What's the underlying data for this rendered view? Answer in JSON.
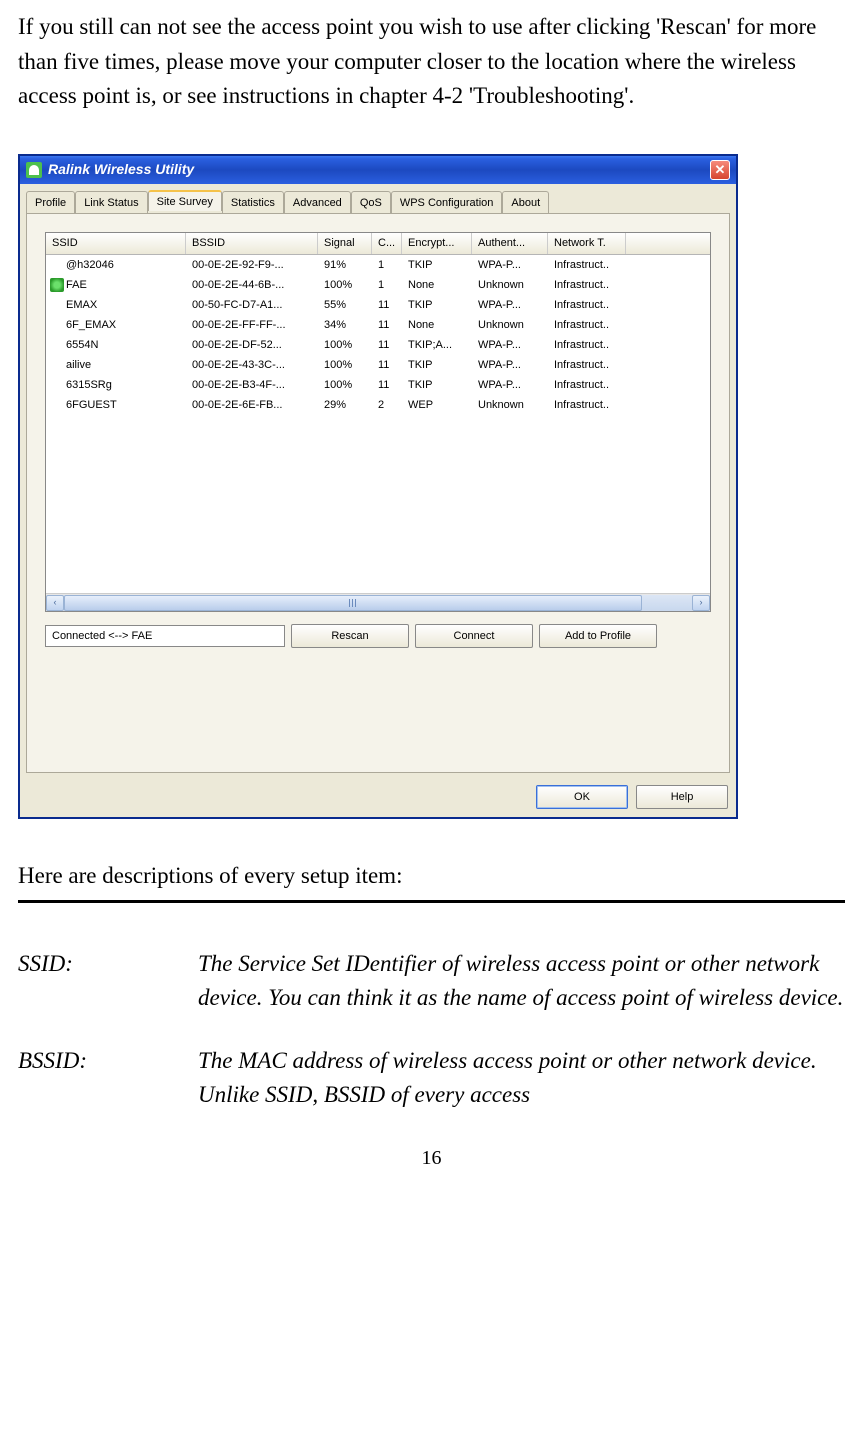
{
  "intro": "If you still can not see the access point you wish to use after clicking 'Rescan' for more than five times, please move your computer closer to the location where the wireless access point is, or see instructions in chapter 4-2 'Troubleshooting'.",
  "window": {
    "title": "Ralink Wireless Utility",
    "tabs": [
      "Profile",
      "Link Status",
      "Site Survey",
      "Statistics",
      "Advanced",
      "QoS",
      "WPS Configuration",
      "About"
    ],
    "active_tab": 2,
    "columns": [
      "SSID",
      "BSSID",
      "Signal",
      "C...",
      "Encrypt...",
      "Authent...",
      "Network T."
    ],
    "rows": [
      {
        "connected": false,
        "ssid": "@h32046",
        "bssid": "00-0E-2E-92-F9-...",
        "signal": "91%",
        "ch": "1",
        "enc": "TKIP",
        "auth": "WPA-P...",
        "net": "Infrastruct.."
      },
      {
        "connected": true,
        "ssid": "FAE",
        "bssid": "00-0E-2E-44-6B-...",
        "signal": "100%",
        "ch": "1",
        "enc": "None",
        "auth": "Unknown",
        "net": "Infrastruct.."
      },
      {
        "connected": false,
        "ssid": "EMAX",
        "bssid": "00-50-FC-D7-A1...",
        "signal": "55%",
        "ch": "11",
        "enc": "TKIP",
        "auth": "WPA-P...",
        "net": "Infrastruct.."
      },
      {
        "connected": false,
        "ssid": "6F_EMAX",
        "bssid": "00-0E-2E-FF-FF-...",
        "signal": "34%",
        "ch": "11",
        "enc": "None",
        "auth": "Unknown",
        "net": "Infrastruct.."
      },
      {
        "connected": false,
        "ssid": "6554N",
        "bssid": "00-0E-2E-DF-52...",
        "signal": "100%",
        "ch": "11",
        "enc": "TKIP;A...",
        "auth": "WPA-P...",
        "net": "Infrastruct.."
      },
      {
        "connected": false,
        "ssid": "ailive",
        "bssid": "00-0E-2E-43-3C-...",
        "signal": "100%",
        "ch": "11",
        "enc": "TKIP",
        "auth": "WPA-P...",
        "net": "Infrastruct.."
      },
      {
        "connected": false,
        "ssid": "6315SRg",
        "bssid": "00-0E-2E-B3-4F-...",
        "signal": "100%",
        "ch": "11",
        "enc": "TKIP",
        "auth": "WPA-P...",
        "net": "Infrastruct.."
      },
      {
        "connected": false,
        "ssid": "6FGUEST",
        "bssid": "00-0E-2E-6E-FB...",
        "signal": "29%",
        "ch": "2",
        "enc": "WEP",
        "auth": "Unknown",
        "net": "Infrastruct.."
      }
    ],
    "status": "Connected <--> FAE",
    "buttons": {
      "rescan": "Rescan",
      "connect": "Connect",
      "add": "Add to Profile",
      "ok": "OK",
      "help": "Help"
    }
  },
  "desc_lead": "Here are descriptions of every setup item:",
  "definitions": [
    {
      "term": "SSID:",
      "text": "The Service Set IDentifier of wireless access point or other network device. You can think it as the name of access point of wireless device."
    },
    {
      "term": "BSSID:",
      "text": "The MAC address of wireless access point or other network device. Unlike SSID, BSSID of every access"
    }
  ],
  "page_number": "16"
}
